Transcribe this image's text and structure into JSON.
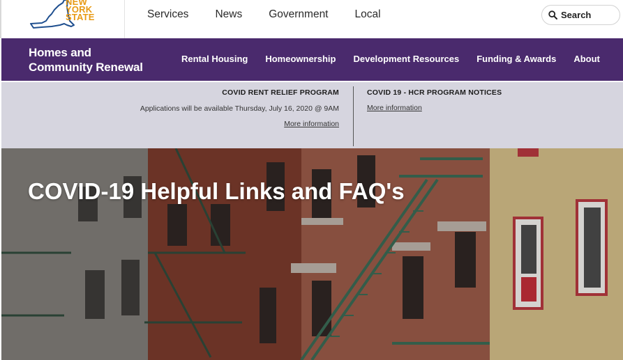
{
  "logo": {
    "lines": [
      "NEW",
      "YORK",
      "STATE"
    ],
    "icon": "new-york-state-outline",
    "color": "#e89a14"
  },
  "global_nav": {
    "items": [
      "Services",
      "News",
      "Government",
      "Local"
    ]
  },
  "search": {
    "label": "Search",
    "icon": "search-icon"
  },
  "agency": {
    "name_line1": "Homes and",
    "name_line2": "Community Renewal",
    "nav": [
      "Rental Housing",
      "Homeownership",
      "Development Resources",
      "Funding & Awards",
      "About"
    ],
    "color": "#4a2a6d"
  },
  "alerts": {
    "left": {
      "title": "COVID RENT RELIEF PROGRAM",
      "text": "Applications will be available Thursday, July 16, 2020 @ 9AM",
      "link": "More information"
    },
    "right": {
      "title": "COVID 19 - HCR PROGRAM NOTICES",
      "link": "More information"
    },
    "background": "#d6d5df"
  },
  "hero": {
    "title": "COVID-19 Helpful Links and FAQ's"
  }
}
